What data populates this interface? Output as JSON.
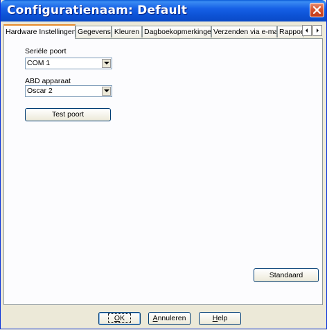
{
  "window": {
    "title": "Configuratienaam: Default"
  },
  "tabs": [
    {
      "label": "Hardware Instellingen",
      "active": true
    },
    {
      "label": "Gegevens"
    },
    {
      "label": "Kleuren"
    },
    {
      "label": "Dagboekopmerkingen"
    },
    {
      "label": "Verzenden via e-mail"
    },
    {
      "label": "Rapport"
    }
  ],
  "hardware": {
    "serial_port_label": "Seriële poort",
    "serial_port_value": "COM 1",
    "abd_label": "ABD apparaat",
    "abd_value": "Oscar 2",
    "test_button": "Test poort",
    "default_button": "Standaard"
  },
  "footer": {
    "ok": {
      "u": "O",
      "rest": "K"
    },
    "cancel": {
      "u": "A",
      "rest": "nnuleren"
    },
    "help": {
      "u": "H",
      "rest": "elp"
    }
  },
  "colors": {
    "titlebar": "#0a4ac6",
    "close": "#d6522d",
    "active_tab_accent": "#e68b2c",
    "window_bg": "#ece9d8"
  }
}
